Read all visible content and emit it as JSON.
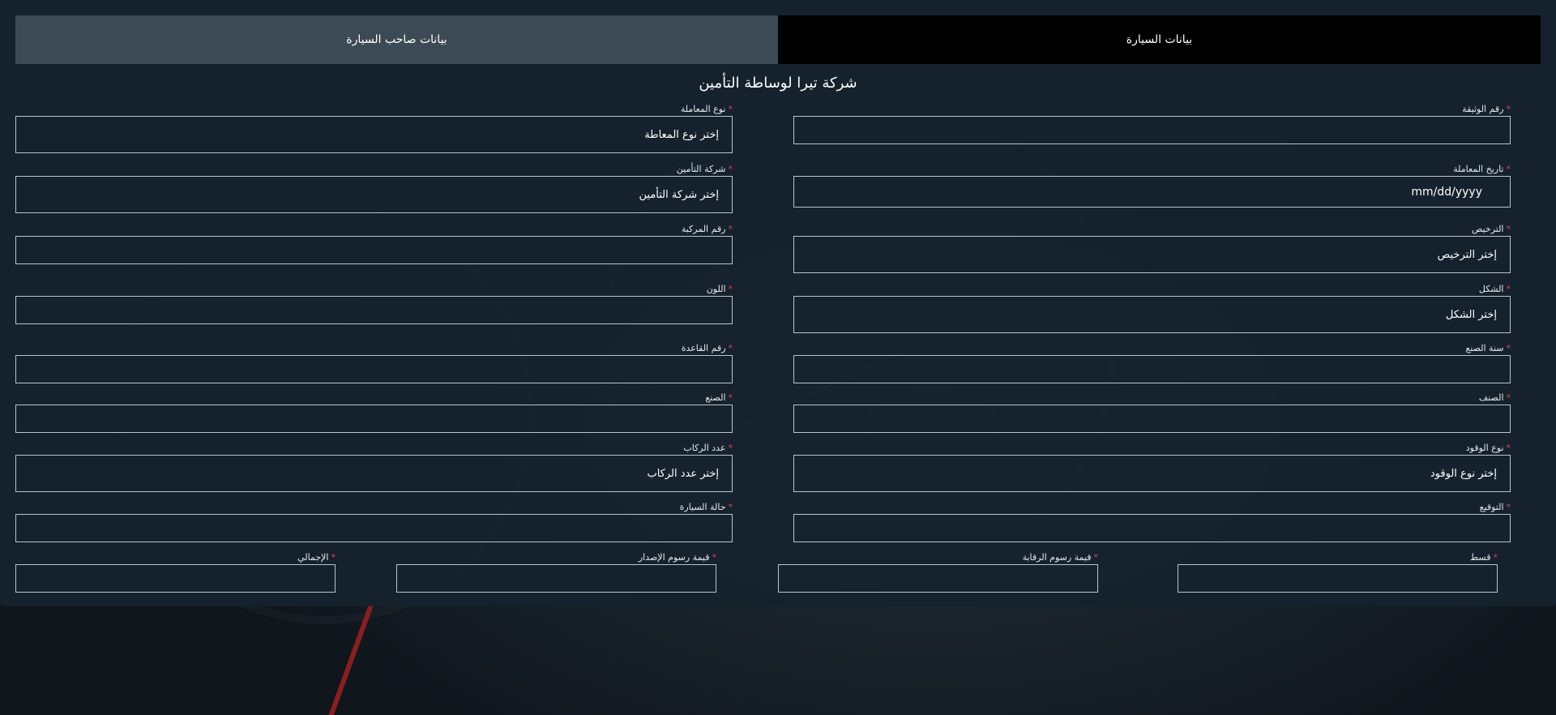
{
  "tabs": {
    "car_data": "بيانات السيارة",
    "owner_data": "بيانات صاحب السيارة"
  },
  "company_title": "شركة تيرا لوساطة التأمين",
  "right_column": {
    "document_number": {
      "label": "رقم الوثيقة",
      "value": ""
    },
    "transaction_date": {
      "label": "تاريخ المعاملة",
      "value": "mm/dd/yyyy"
    },
    "license": {
      "label": "الترخيص",
      "value": "إختر الترخيص"
    },
    "shape": {
      "label": "الشكل",
      "value": "إختر الشكل"
    },
    "manufacture_year": {
      "label": "سنة الصنع",
      "value": ""
    },
    "category": {
      "label": "الصنف",
      "value": ""
    },
    "fuel_type": {
      "label": "نوع الوقود",
      "value": "إختر نوع الوقود"
    },
    "signature": {
      "label": "التوقيع",
      "value": ""
    }
  },
  "left_column": {
    "transaction_type": {
      "label": "نوع المعاملة",
      "value": "إختر نوع المعاطة"
    },
    "insurance_company": {
      "label": "شركة التأمين",
      "value": "إختر شركة التأمين"
    },
    "vehicle_number": {
      "label": "رقم المركبة",
      "value": ""
    },
    "color": {
      "label": "اللون",
      "value": ""
    },
    "chassis_number": {
      "label": "رقم القاعدة",
      "value": ""
    },
    "make": {
      "label": "الصنع",
      "value": ""
    },
    "passengers": {
      "label": "عدد الركاب",
      "value": "إختر عدد الركاب"
    },
    "car_status": {
      "label": "حالة السيارة",
      "value": ""
    }
  },
  "bottom_row": {
    "installment": {
      "label": "قسط",
      "value": ""
    },
    "inspection_fee": {
      "label": "قيمة رسوم الرقابة",
      "value": ""
    },
    "issuance_fee": {
      "label": "قيمة رسوم الإصدار",
      "value": ""
    },
    "total": {
      "label": "الإجمالي",
      "value": ""
    }
  },
  "required_mark": "*",
  "colors": {
    "panel": "#15222e",
    "active_tab": "#000000",
    "inactive_tab": "#3b4a54",
    "required": "#e0404c",
    "border": "#b9c3ca"
  }
}
